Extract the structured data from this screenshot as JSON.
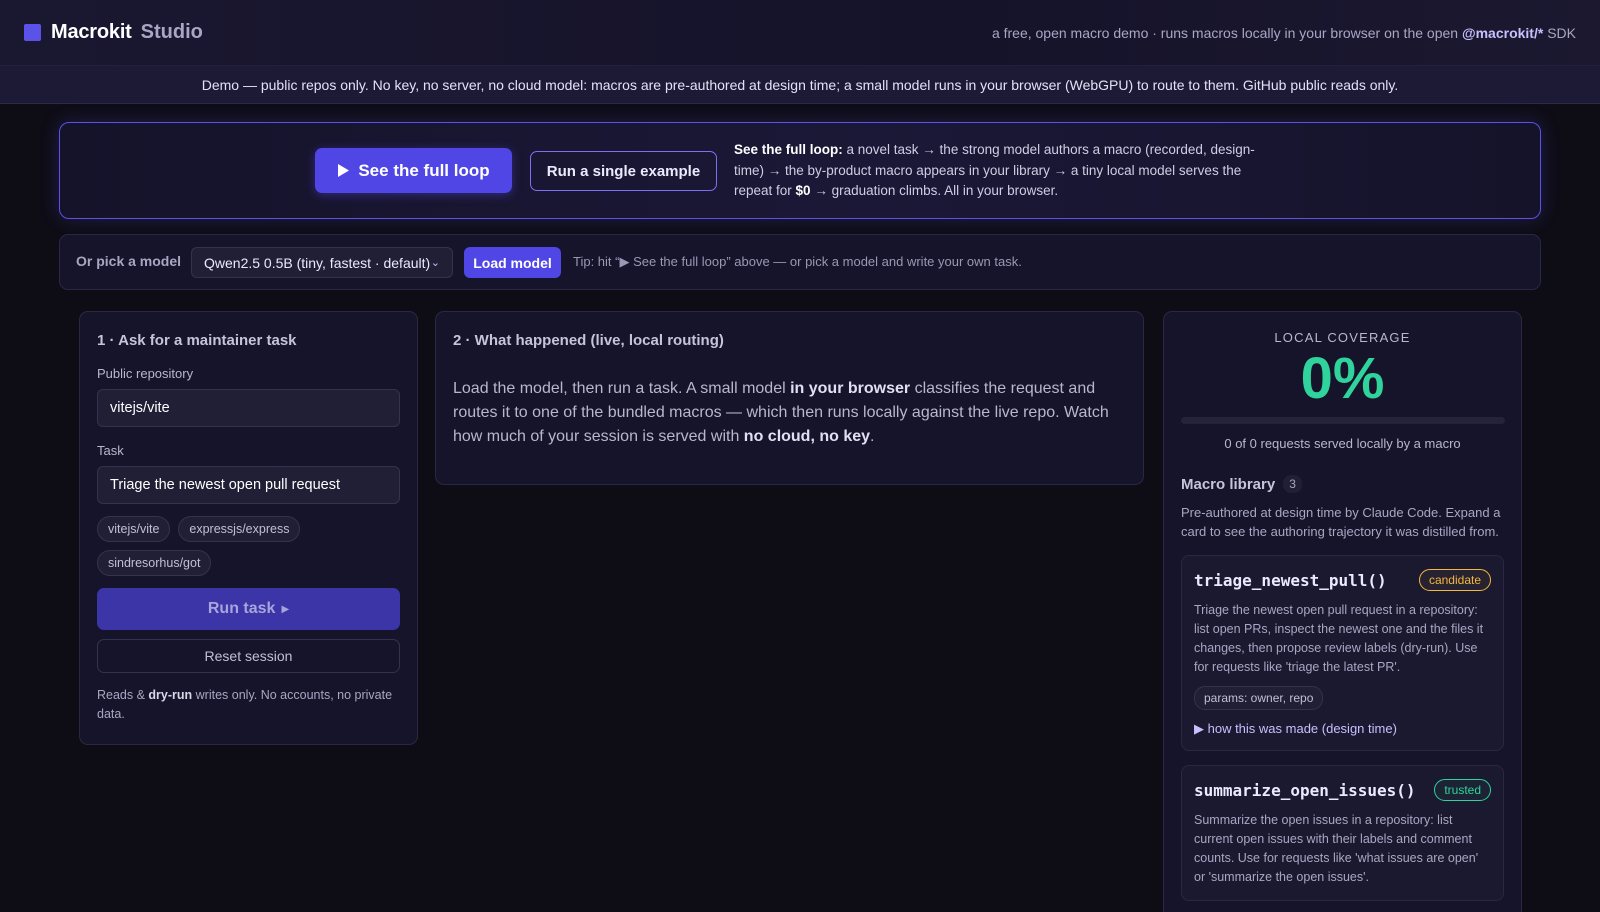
{
  "header": {
    "brand": "Macrokit",
    "brand_sub": "Studio",
    "tagline_pre": "a free, open macro demo · runs macros locally in your browser on the open ",
    "sdk_link": "@macrokit/*",
    "tagline_post": " SDK"
  },
  "banner": {
    "text": "Demo — public repos only. No key, no server, no cloud model: macros are pre-authored at design time; a small model runs in your browser (WebGPU) to route to them. GitHub public reads only."
  },
  "hero": {
    "primary_icon": "play-icon",
    "primary_label": "See the full loop",
    "secondary_label": "Run a single example",
    "desc_bold": "See the full loop:",
    "desc_1": " a novel task → the strong model authors a macro (recorded, design-time) → the by-product macro appears in your library → a tiny local model serves the repeat for ",
    "desc_price": "$0",
    "desc_2": " → graduation climbs. All in your browser."
  },
  "model_row": {
    "label": "Or pick a model",
    "selected_model": "Qwen2.5 0.5B (tiny, fastest · default)",
    "load_label": "Load model",
    "tip": "Tip: hit “▶ See the full loop” above — or pick a model and write your own task."
  },
  "panel1": {
    "title": "1 · Ask for a maintainer task",
    "repo_label": "Public repository",
    "repo_value": "vitejs/vite",
    "task_label": "Task",
    "task_value": "Triage the newest open pull request",
    "chips": [
      "vitejs/vite",
      "expressjs/express",
      "sindresorhus/got"
    ],
    "run_label": "Run task",
    "reset_label": "Reset session",
    "note_pre": "Reads & ",
    "note_bold": "dry-run",
    "note_post": " writes only. No accounts, no private data."
  },
  "panel2": {
    "title": "2 · What happened (live, local routing)",
    "body_1": "Load the model, then run a task. A small model ",
    "body_bold_1": "in your browser",
    "body_2": " classifies the request and routes it to one of the bundled macros — which then runs locally against the live repo. Watch how much of your session is served with ",
    "body_bold_2": "no cloud, no key",
    "body_3": "."
  },
  "panel3": {
    "coverage_label": "LOCAL COVERAGE",
    "coverage_value": "0%",
    "coverage_fraction": 0,
    "coverage_sub": "0 of 0 requests served locally by a macro",
    "library_title": "Macro library",
    "library_count": "3",
    "library_desc": "Pre-authored at design time by Claude Code. Expand a card to see the authoring trajectory it was distilled from.",
    "macros": [
      {
        "name": "triage_newest_pull()",
        "badge": "candidate",
        "desc": "Triage the newest open pull request in a repository: list open PRs, inspect the newest one and the files it changes, then propose review labels (dry-run). Use for requests like 'triage the latest PR'.",
        "params": "params: owner, repo",
        "how_made": "▶ how this was made (design time)"
      },
      {
        "name": "summarize_open_issues()",
        "badge": "trusted",
        "desc": "Summarize the open issues in a repository: list current open issues with their labels and comment counts. Use for requests like 'what issues are open' or 'summarize the open issues'."
      }
    ]
  },
  "colors": {
    "accent": "#4f46e5",
    "coverage_green": "#2fd39b",
    "candidate_amber": "#f4b740",
    "background": "#0e0d16"
  }
}
